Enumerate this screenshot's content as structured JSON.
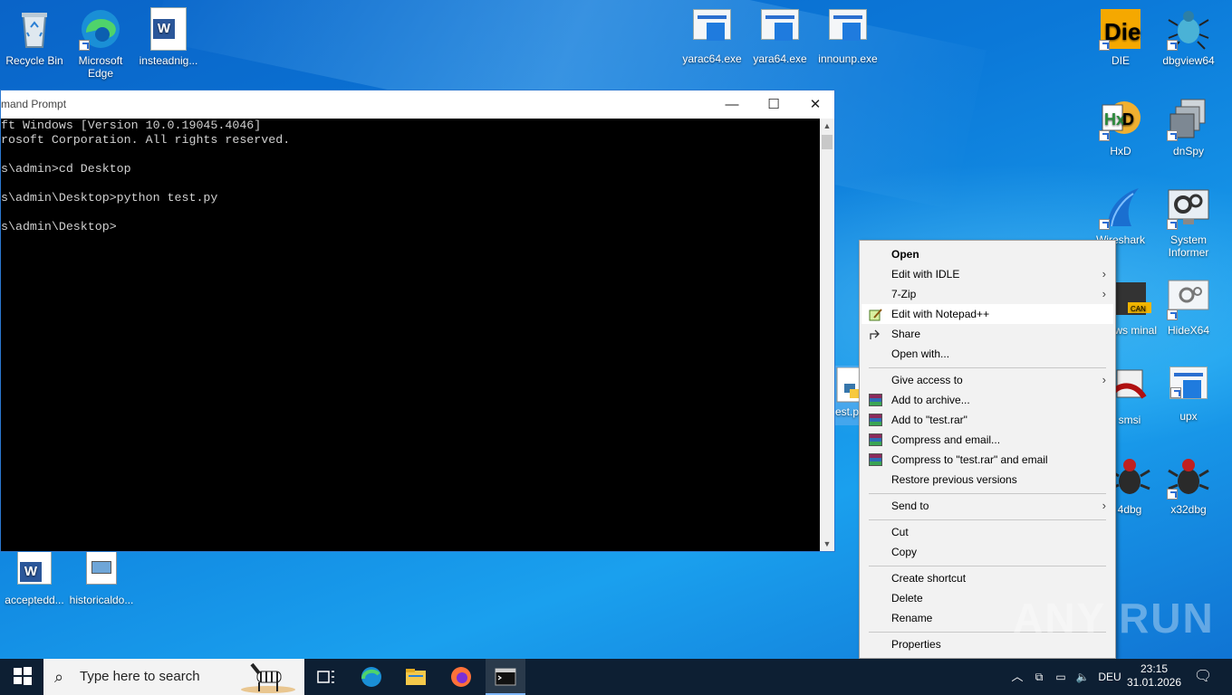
{
  "desktop": {
    "icons_left": [
      {
        "label": "Recycle Bin",
        "icon": "recycle-bin-icon"
      },
      {
        "label": "Microsoft Edge",
        "icon": "edge-icon"
      },
      {
        "label": "insteadnig...",
        "icon": "word-doc-icon"
      }
    ],
    "icons_top": [
      {
        "label": "yarac64.exe",
        "icon": "exe-icon"
      },
      {
        "label": "yara64.exe",
        "icon": "exe-icon"
      },
      {
        "label": "innounp.exe",
        "icon": "exe-icon"
      }
    ],
    "icons_right": [
      {
        "label": "DIE",
        "icon": "die-icon"
      },
      {
        "label": "dbgview64",
        "icon": "dbgview-icon"
      },
      {
        "label": "HxD",
        "icon": "hxd-icon"
      },
      {
        "label": "dnSpy",
        "icon": "dnspy-icon"
      },
      {
        "label": "Wireshark",
        "icon": "wireshark-icon"
      },
      {
        "label": "System Informer",
        "icon": "system-informer-icon"
      },
      {
        "label": "dows minal",
        "icon": "terminal-icon"
      },
      {
        "label": "HideX64",
        "icon": "hidex64-icon"
      },
      {
        "label": "smsi",
        "icon": "smsi-icon"
      },
      {
        "label": "upx",
        "icon": "upx-icon"
      },
      {
        "label": "4dbg",
        "icon": "x64dbg-icon"
      },
      {
        "label": "x32dbg",
        "icon": "x32dbg-icon"
      }
    ],
    "icons_bottom": [
      {
        "label": "acceptedd...",
        "icon": "word-doc-icon"
      },
      {
        "label": "historicaldo...",
        "icon": "image-icon"
      }
    ],
    "partial_file_label": "est.p"
  },
  "cmd": {
    "title": "mand Prompt",
    "lines": [
      "ft Windows [Version 10.0.19045.4046]",
      "rosoft Corporation. All rights reserved.",
      "",
      "s\\admin>cd Desktop",
      "",
      "s\\admin\\Desktop>python test.py",
      "",
      "s\\admin\\Desktop>"
    ],
    "minimize": "—",
    "maximize": "☐",
    "close": "✕"
  },
  "context_menu": {
    "items": [
      {
        "label": "Open",
        "bold": true,
        "icon": "",
        "submenu": false
      },
      {
        "label": "Edit with IDLE",
        "icon": "",
        "submenu": true
      },
      {
        "label": "7-Zip",
        "icon": "",
        "submenu": true
      },
      {
        "label": "Edit with Notepad++",
        "icon": "notepadpp-icon",
        "submenu": false,
        "highlighted": true
      },
      {
        "label": "Share",
        "icon": "share-icon",
        "submenu": false
      },
      {
        "label": "Open with...",
        "icon": "",
        "submenu": false
      },
      {
        "label": "Give access to",
        "icon": "",
        "submenu": true
      },
      {
        "label": "Add to archive...",
        "icon": "winrar-icon",
        "submenu": false
      },
      {
        "label": "Add to \"test.rar\"",
        "icon": "winrar-icon",
        "submenu": false
      },
      {
        "label": "Compress and email...",
        "icon": "winrar-icon",
        "submenu": false
      },
      {
        "label": "Compress to \"test.rar\" and email",
        "icon": "winrar-icon",
        "submenu": false
      },
      {
        "label": "Restore previous versions",
        "icon": "",
        "submenu": false
      },
      {
        "label": "Send to",
        "icon": "",
        "submenu": true
      },
      {
        "label": "Cut",
        "icon": "",
        "submenu": false
      },
      {
        "label": "Copy",
        "icon": "",
        "submenu": false
      },
      {
        "label": "Create shortcut",
        "icon": "",
        "submenu": false
      },
      {
        "label": "Delete",
        "icon": "",
        "submenu": false
      },
      {
        "label": "Rename",
        "icon": "",
        "submenu": false
      },
      {
        "label": "Properties",
        "icon": "",
        "submenu": false
      }
    ]
  },
  "taskbar": {
    "search_placeholder": "Type here to search",
    "language": "DEU",
    "time": "23:15",
    "date": "31.01.2026"
  },
  "watermark": "ANY RUN"
}
